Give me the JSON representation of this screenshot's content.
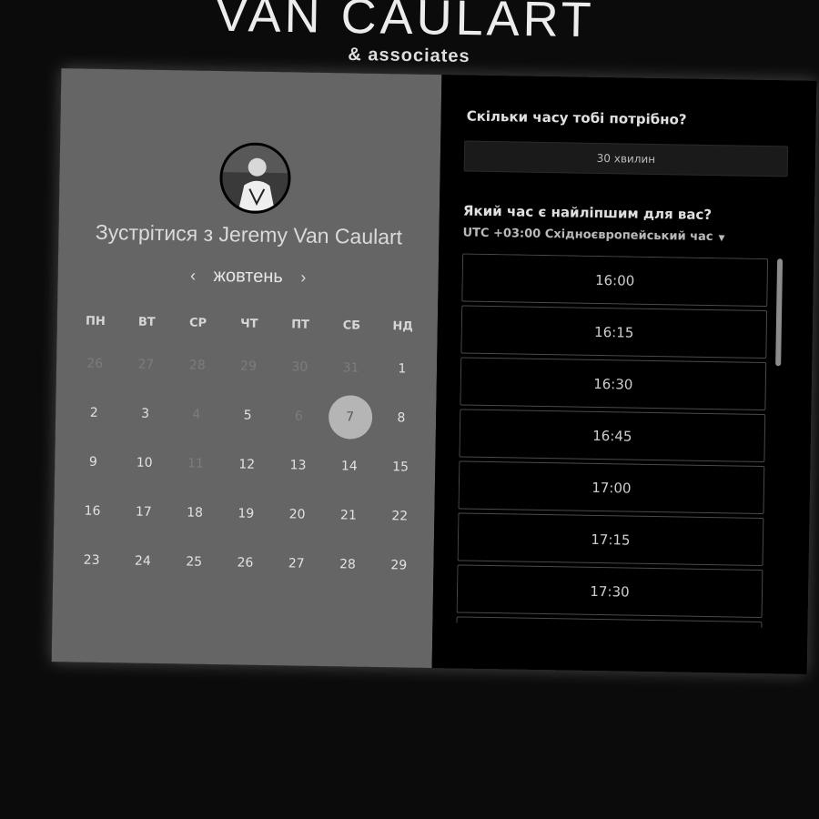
{
  "brand": {
    "title": "VAN CAULART",
    "subtitle": "& associates"
  },
  "profile": {
    "meet_prefix": "Зустрітися з",
    "host_name": "Jeremy Van Caulart"
  },
  "calendar": {
    "month": "жовтень",
    "prev": "‹",
    "next": "›",
    "weekdays": [
      "ПН",
      "ВТ",
      "СР",
      "ЧТ",
      "ПТ",
      "СБ",
      "НД"
    ],
    "weeks": [
      [
        "26",
        "27",
        "28",
        "29",
        "30",
        "31",
        "1"
      ],
      [
        "2",
        "3",
        "4",
        "5",
        "6",
        "7",
        "8"
      ],
      [
        "9",
        "10",
        "11",
        "12",
        "13",
        "14",
        "15"
      ],
      [
        "16",
        "17",
        "18",
        "19",
        "20",
        "21",
        "22"
      ],
      [
        "23",
        "24",
        "25",
        "26",
        "27",
        "28",
        "29"
      ]
    ],
    "selected_day": "7"
  },
  "booking": {
    "duration_question": "Скільки часу тобі потрібно?",
    "duration_value": "30 хвилин",
    "time_question": "Який час є найліпшим для вас?",
    "timezone": "UTC +03:00 Східноєвропейський час",
    "slots": [
      "16:00",
      "16:15",
      "16:30",
      "16:45",
      "17:00",
      "17:15",
      "17:30",
      ""
    ]
  }
}
